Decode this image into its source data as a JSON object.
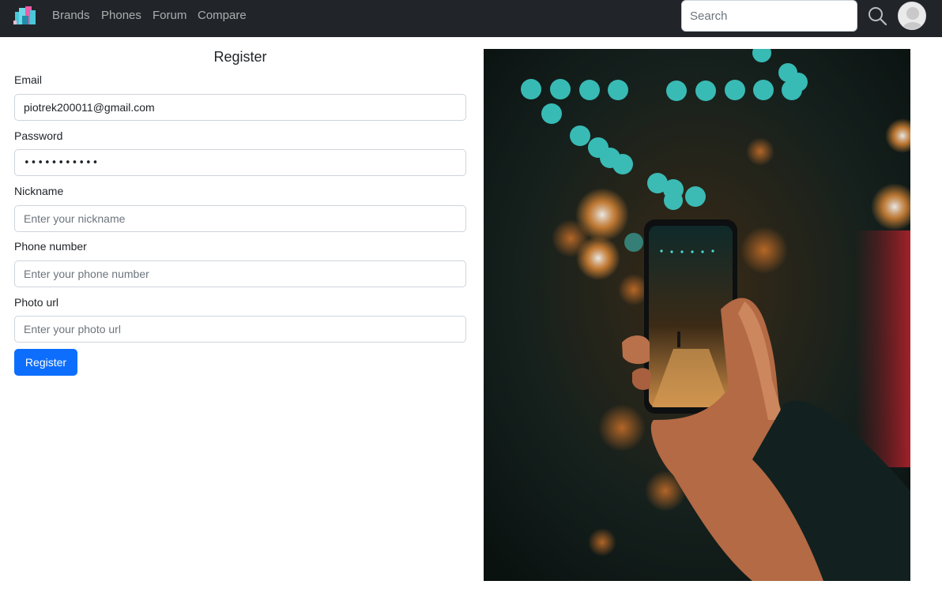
{
  "navbar": {
    "links": [
      {
        "label": "Brands"
      },
      {
        "label": "Phones"
      },
      {
        "label": "Forum"
      },
      {
        "label": "Compare"
      }
    ],
    "search": {
      "placeholder": "Search",
      "value": ""
    },
    "icons": {
      "logo": "app-logo-icon",
      "search": "search-icon",
      "avatar": "user-avatar-icon"
    }
  },
  "form": {
    "title": "Register",
    "fields": [
      {
        "label": "Email",
        "value": "piotrek200011@gmail.com",
        "placeholder": ""
      },
      {
        "label": "Password",
        "value": "•••••••••••",
        "placeholder": ""
      },
      {
        "label": "Nickname",
        "value": "",
        "placeholder": "Enter your nickname"
      },
      {
        "label": "Phone number",
        "value": "",
        "placeholder": "Enter your phone number"
      },
      {
        "label": "Photo url",
        "value": "",
        "placeholder": "Enter your photo url"
      }
    ],
    "submit_label": "Register"
  },
  "colors": {
    "navbar_bg": "#212529",
    "primary": "#0d6efd",
    "input_border": "#ced4da"
  }
}
